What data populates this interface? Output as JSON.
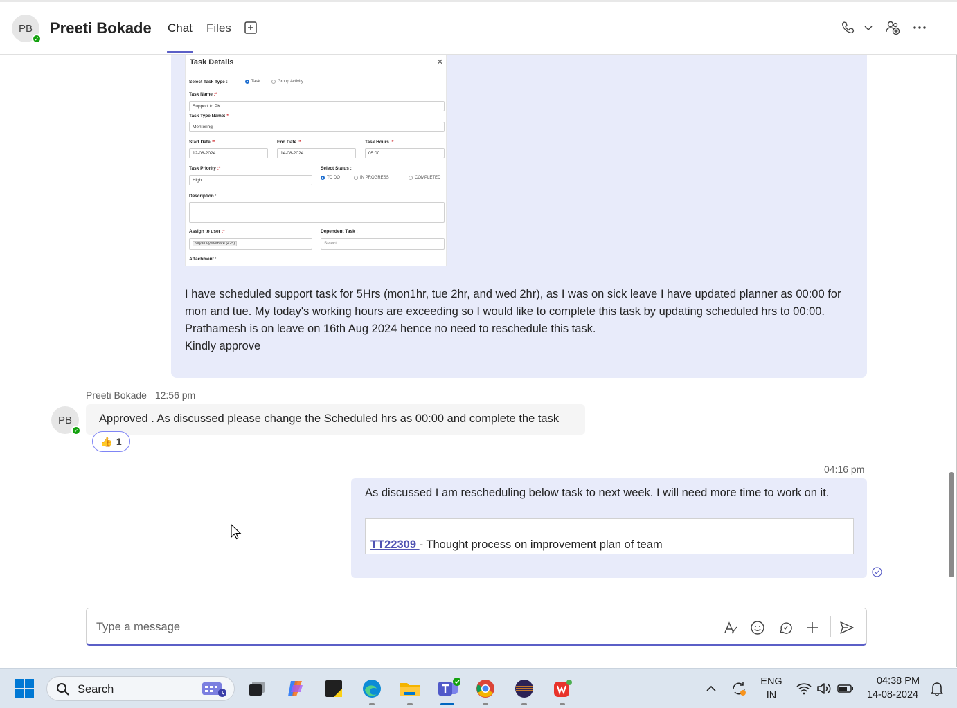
{
  "header": {
    "avatar_initials": "PB",
    "contact_name": "Preeti Bokade",
    "tabs": [
      {
        "label": "Chat",
        "active": true
      },
      {
        "label": "Files",
        "active": false
      }
    ],
    "icons": [
      "add-tab-icon",
      "phone-icon",
      "chevron-down-icon",
      "add-people-icon",
      "more-options-icon"
    ]
  },
  "task_details": {
    "title": "Task Details",
    "select_task_type_label": "Select Task Type :",
    "task_option": "Task",
    "group_option": "Group Activity",
    "task_name_label": "Task Name",
    "task_name_value": "Support to PK",
    "task_type_label": "Task Type Name:",
    "task_type_value": "Mentoring",
    "start_date_label": "Start Date",
    "start_date_value": "12-08-2024",
    "end_date_label": "End Date",
    "end_date_value": "14-08-2024",
    "task_hours_label": "Task Hours",
    "task_hours_value": "05:00",
    "priority_label": "Task Priority",
    "priority_value": "High",
    "status_label": "Select Status :",
    "status_todo": "TO DO",
    "status_progress": "IN PROGRESS",
    "status_completed": "COMPLETED",
    "description_label": "Description :",
    "assign_label": "Assign to user",
    "assign_chip": "Sayali Vyawahare (425)",
    "dependent_label": "Dependent Task :",
    "dependent_placeholder": "Select...",
    "attachment_label": "Attachment :"
  },
  "message_1": {
    "line1": "I have scheduled support task for 5Hrs (mon1hr, tue 2hr, and wed 2hr), as I was on sick leave I have updated planner as 00:00 for mon and tue. My today's working hours are exceeding so I would like to complete this task by updating scheduled hrs to 00:00.",
    "line2": "Prathamesh is on leave on 16th Aug 2024 hence no need to reschedule this task.",
    "line3": "Kindly approve"
  },
  "message_2": {
    "avatar_initials": "PB",
    "sender": "Preeti Bokade",
    "time": "12:56 pm",
    "text": "Approved . As discussed please change the Scheduled hrs as 00:00 and complete the task",
    "reaction_emoji": "👍",
    "reaction_count": "1"
  },
  "message_3": {
    "time": "04:16 pm",
    "text": "As discussed I am rescheduling below task to next week. I will need more time to work on it.",
    "link_text": "TT22309 ",
    "link_rest": " - Thought process on improvement plan of team"
  },
  "compose": {
    "placeholder": "Type a message",
    "icons": [
      "format-icon",
      "emoji-icon",
      "loop-icon",
      "attach-plus-icon",
      "send-icon"
    ]
  },
  "taskbar": {
    "search_label": "Search",
    "lang_top": "ENG",
    "lang_bottom": "IN",
    "time": "04:38 PM",
    "date": "14-08-2024"
  },
  "colors": {
    "accent": "#5b5fc7",
    "bubble_self": "#e8ebfa",
    "bubble_other": "#f5f5f5",
    "presence": "#13a10e"
  }
}
